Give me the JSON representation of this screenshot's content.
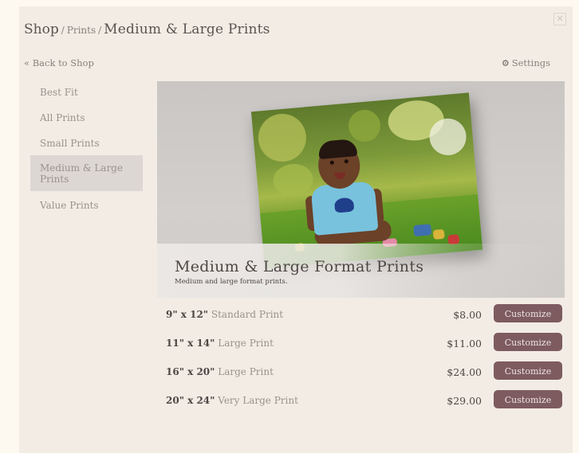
{
  "breadcrumb": {
    "shop": "Shop",
    "sep1": "/",
    "prints": "Prints",
    "sep2": "/",
    "current": "Medium & Large Prints"
  },
  "close_icon": "close-icon",
  "nav": {
    "back_label": "« Back to Shop",
    "settings_label": "Settings"
  },
  "sidebar": {
    "items": [
      {
        "label": "Best Fit"
      },
      {
        "label": "All Prints"
      },
      {
        "label": "Small Prints"
      },
      {
        "label": "Medium & Large Prints",
        "selected": true
      },
      {
        "label": "Value Prints"
      }
    ]
  },
  "hero": {
    "title": "Medium & Large Format Prints",
    "subtitle": "Medium and large format prints."
  },
  "products": [
    {
      "size": "9\" x 12\"",
      "name": "Standard Print",
      "price": "$8.00",
      "button": "Customize"
    },
    {
      "size": "11\" x 14\"",
      "name": "Large Print",
      "price": "$11.00",
      "button": "Customize"
    },
    {
      "size": "16\" x 20\"",
      "name": "Large Print",
      "price": "$24.00",
      "button": "Customize"
    },
    {
      "size": "20\" x 24\"",
      "name": "Very Large Print",
      "price": "$29.00",
      "button": "Customize"
    }
  ],
  "colors": {
    "page_bg": "#fdf9f1",
    "panel_bg": "#f2ece5",
    "button_bg": "#7d5b5f",
    "selected_nav_bg": "#dcd7d3"
  }
}
